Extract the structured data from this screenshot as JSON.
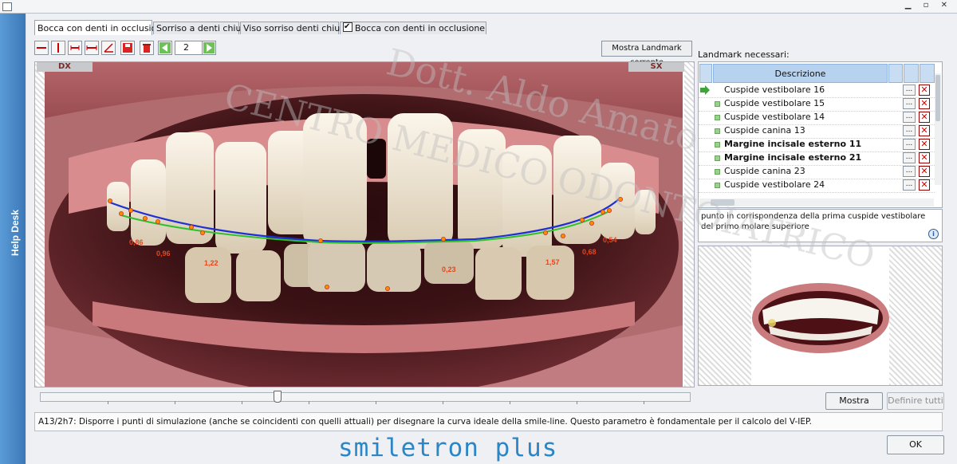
{
  "helpdesk": {
    "label": "Help Desk"
  },
  "tabs": [
    {
      "label": "Bocca con denti in occlusione",
      "active": true
    },
    {
      "label": "Sorriso a denti chiusi"
    },
    {
      "label": "Viso sorriso denti chiusi"
    },
    {
      "label": "Bocca con denti in occlusione",
      "checked": true
    }
  ],
  "toolbar": {
    "page_value": "2",
    "show_landmark_label": "Mostra Landmark corrente"
  },
  "photo": {
    "dx_label": "DX",
    "sx_label": "SX",
    "measurements": [
      "0,86",
      "0,96",
      "1,22",
      "0,23",
      "1,57",
      "0,68",
      "0,54"
    ],
    "line_colors": {
      "ideal": "#1f2fd6",
      "actual": "#2dc12d",
      "points": "#ff8c00"
    }
  },
  "landmarks": {
    "title": "Landmark necessari:",
    "column_header": "Descrizione",
    "rows": [
      {
        "label": "Cuspide vestibolare 16",
        "current": true,
        "bold": false
      },
      {
        "label": "Cuspide vestibolare 15",
        "current": false,
        "bold": false
      },
      {
        "label": "Cuspide vestibolare 14",
        "current": false,
        "bold": false
      },
      {
        "label": "Cuspide canina 13",
        "current": false,
        "bold": false
      },
      {
        "label": "Margine incisale esterno 11",
        "current": false,
        "bold": true
      },
      {
        "label": "Margine incisale esterno 21",
        "current": false,
        "bold": true
      },
      {
        "label": "Cuspide canina 23",
        "current": false,
        "bold": false
      },
      {
        "label": "Cuspide vestibolare 24",
        "current": false,
        "bold": false
      }
    ],
    "row_button_label": "...",
    "description": "punto in corrispondenza della prima cuspide vestibolare del primo molare superiore"
  },
  "buttons": {
    "mostra": "Mostra",
    "definire_tutti": "Definire tutti",
    "ok": "OK"
  },
  "status_text": "A13/2h7: Disporre i punti di simulazione (anche se coincidenti con quelli attuali) per disegnare la curva ideale della smile-line. Questo parametro è fondamentale per il calcolo del V-IEP.",
  "brand": "smiletron plus",
  "watermark": {
    "line1": "Dott. Aldo Amato",
    "line2": "CENTRO MEDICO ODONTOIATRICO"
  }
}
